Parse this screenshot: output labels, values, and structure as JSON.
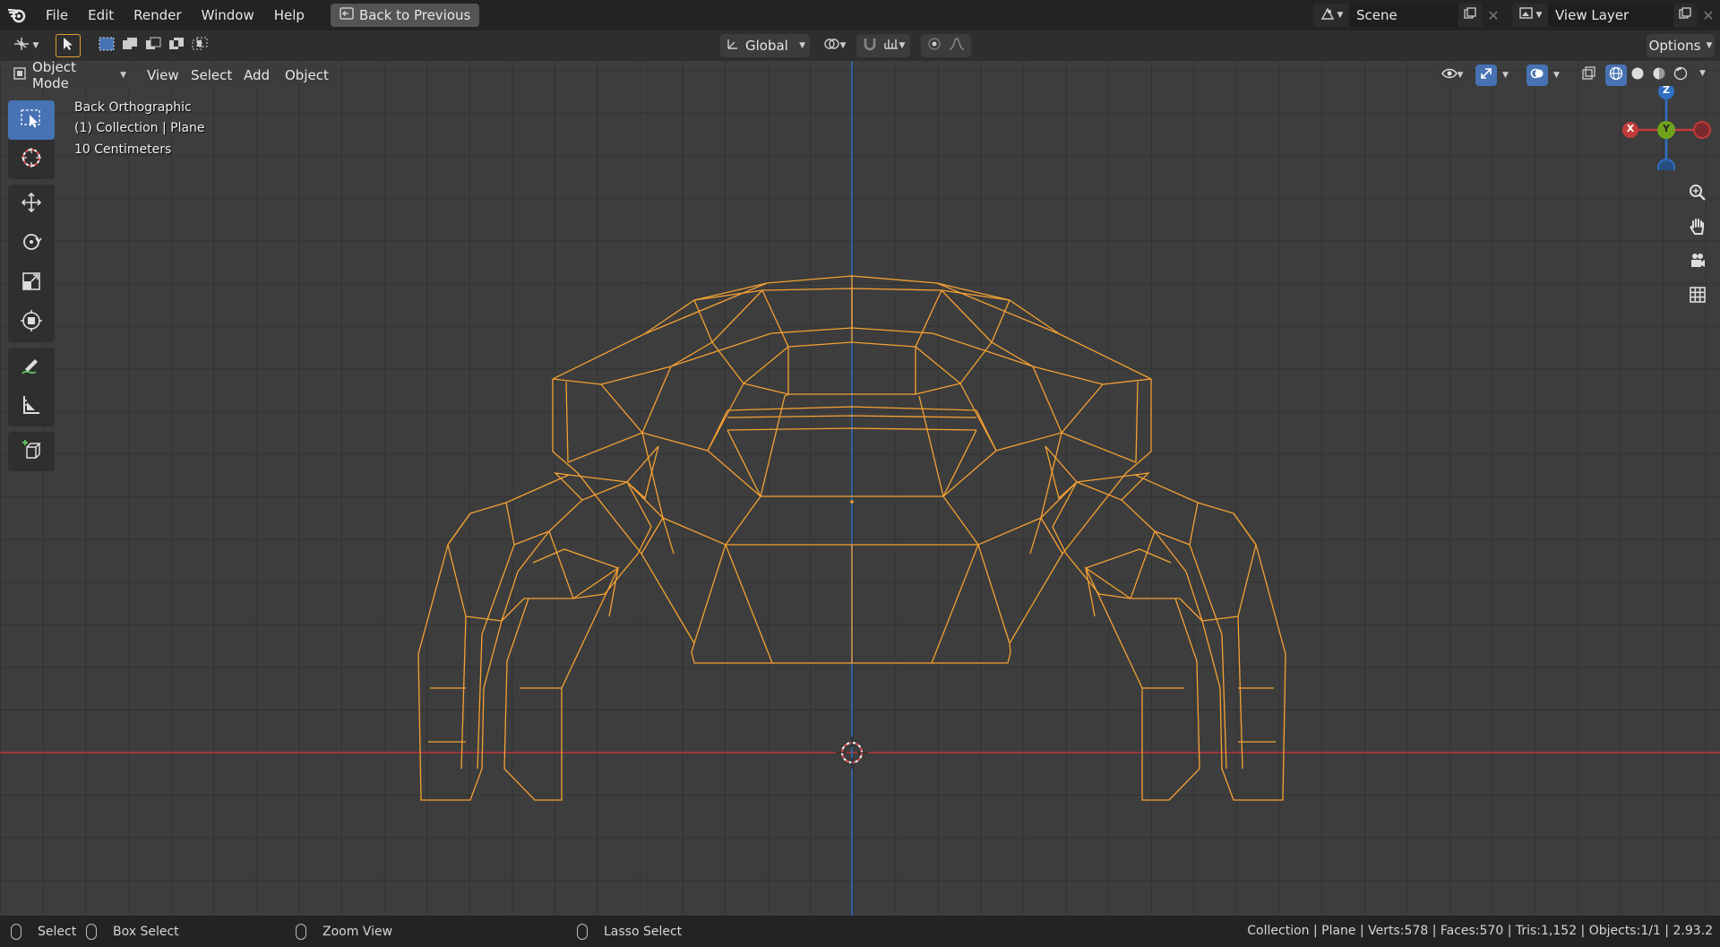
{
  "menubar": {
    "items": [
      "File",
      "Edit",
      "Render",
      "Window",
      "Help"
    ],
    "back_button": "Back to Previous",
    "scene_name": "Scene",
    "view_layer_name": "View Layer"
  },
  "toolheader": {
    "transform_orientation": "Global",
    "options_label": "Options"
  },
  "viewport_header": {
    "mode": "Object Mode",
    "menus": [
      "View",
      "Select",
      "Add",
      "Object"
    ]
  },
  "viewport": {
    "view_name": "Back Orthographic",
    "collection_info": "(1) Collection | Plane",
    "scale_info": "10 Centimeters",
    "gizmo": {
      "z": "Z",
      "y": "Y",
      "x": "X"
    },
    "wire_color": "#f5a133",
    "x_axis_color": "#c23b3b",
    "z_axis_color": "#2f6fc4"
  },
  "statusbar": {
    "select": "Select",
    "box_select": "Box Select",
    "zoom_view": "Zoom View",
    "lasso_select": "Lasso Select",
    "stats": "Collection | Plane | Verts:578 | Faces:570 | Tris:1,152 | Objects:1/1 | 2.93.2"
  }
}
